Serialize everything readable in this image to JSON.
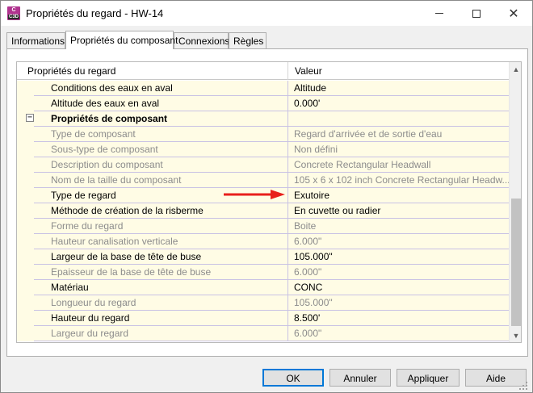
{
  "window": {
    "title": "Propriétés du regard - HW-14",
    "app_icon": {
      "letter": "C",
      "sub": "C3D",
      "color": "#b0338f"
    }
  },
  "tabs": [
    {
      "label": "Informations",
      "active": false
    },
    {
      "label": "Propriétés du composant",
      "active": true
    },
    {
      "label": "Connexions",
      "active": false
    },
    {
      "label": "Règles",
      "active": false
    }
  ],
  "grid": {
    "headers": {
      "property": "Propriétés du regard",
      "value": "Valeur"
    },
    "rows": [
      {
        "name": "Conditions des eaux en aval",
        "value": "Altitude",
        "enabled": true
      },
      {
        "name": "Altitude des eaux en aval",
        "value": "0.000'",
        "enabled": true
      },
      {
        "name": "Propriétés de composant",
        "value": "",
        "category": true,
        "expander": "−"
      },
      {
        "name": "Type de composant",
        "value": "Regard d'arrivée et de sortie d'eau",
        "enabled": false
      },
      {
        "name": "Sous-type de composant",
        "value": "Non défini",
        "enabled": false
      },
      {
        "name": "Description du composant",
        "value": "Concrete Rectangular Headwall",
        "enabled": false
      },
      {
        "name": "Nom de la taille du composant",
        "value": "105 x 6 x 102 inch Concrete Rectangular Headw...",
        "enabled": false
      },
      {
        "name": "Type de regard",
        "value": "Exutoire",
        "enabled": true
      },
      {
        "name": "Méthode de création de la risberme",
        "value": "En cuvette ou radier",
        "enabled": true
      },
      {
        "name": "Forme du regard",
        "value": "Boite",
        "enabled": false
      },
      {
        "name": "Hauteur canalisation verticale",
        "value": "6.000\"",
        "enabled": false
      },
      {
        "name": "Largeur de la base de tête de buse",
        "value": "105.000\"",
        "enabled": true
      },
      {
        "name": "Epaisseur de la base de tête de buse",
        "value": "6.000\"",
        "enabled": false
      },
      {
        "name": "Matériau",
        "value": "CONC",
        "enabled": true
      },
      {
        "name": "Longueur du regard",
        "value": "105.000\"",
        "enabled": false
      },
      {
        "name": "Hauteur du regard",
        "value": "8.500'",
        "enabled": true
      },
      {
        "name": "Largeur du regard",
        "value": "6.000\"",
        "enabled": false
      }
    ],
    "scroll_position": 0.75
  },
  "annotation": {
    "arrow_color": "#e8201c",
    "points_to": "Exutoire"
  },
  "buttons": {
    "ok": "OK",
    "cancel": "Annuler",
    "apply": "Appliquer",
    "help": "Aide"
  },
  "colors": {
    "row_background": "#fffce5",
    "row_separator": "#c9c2e4",
    "disabled_text": "#8c8c8c",
    "ok_border": "#0078d7"
  }
}
